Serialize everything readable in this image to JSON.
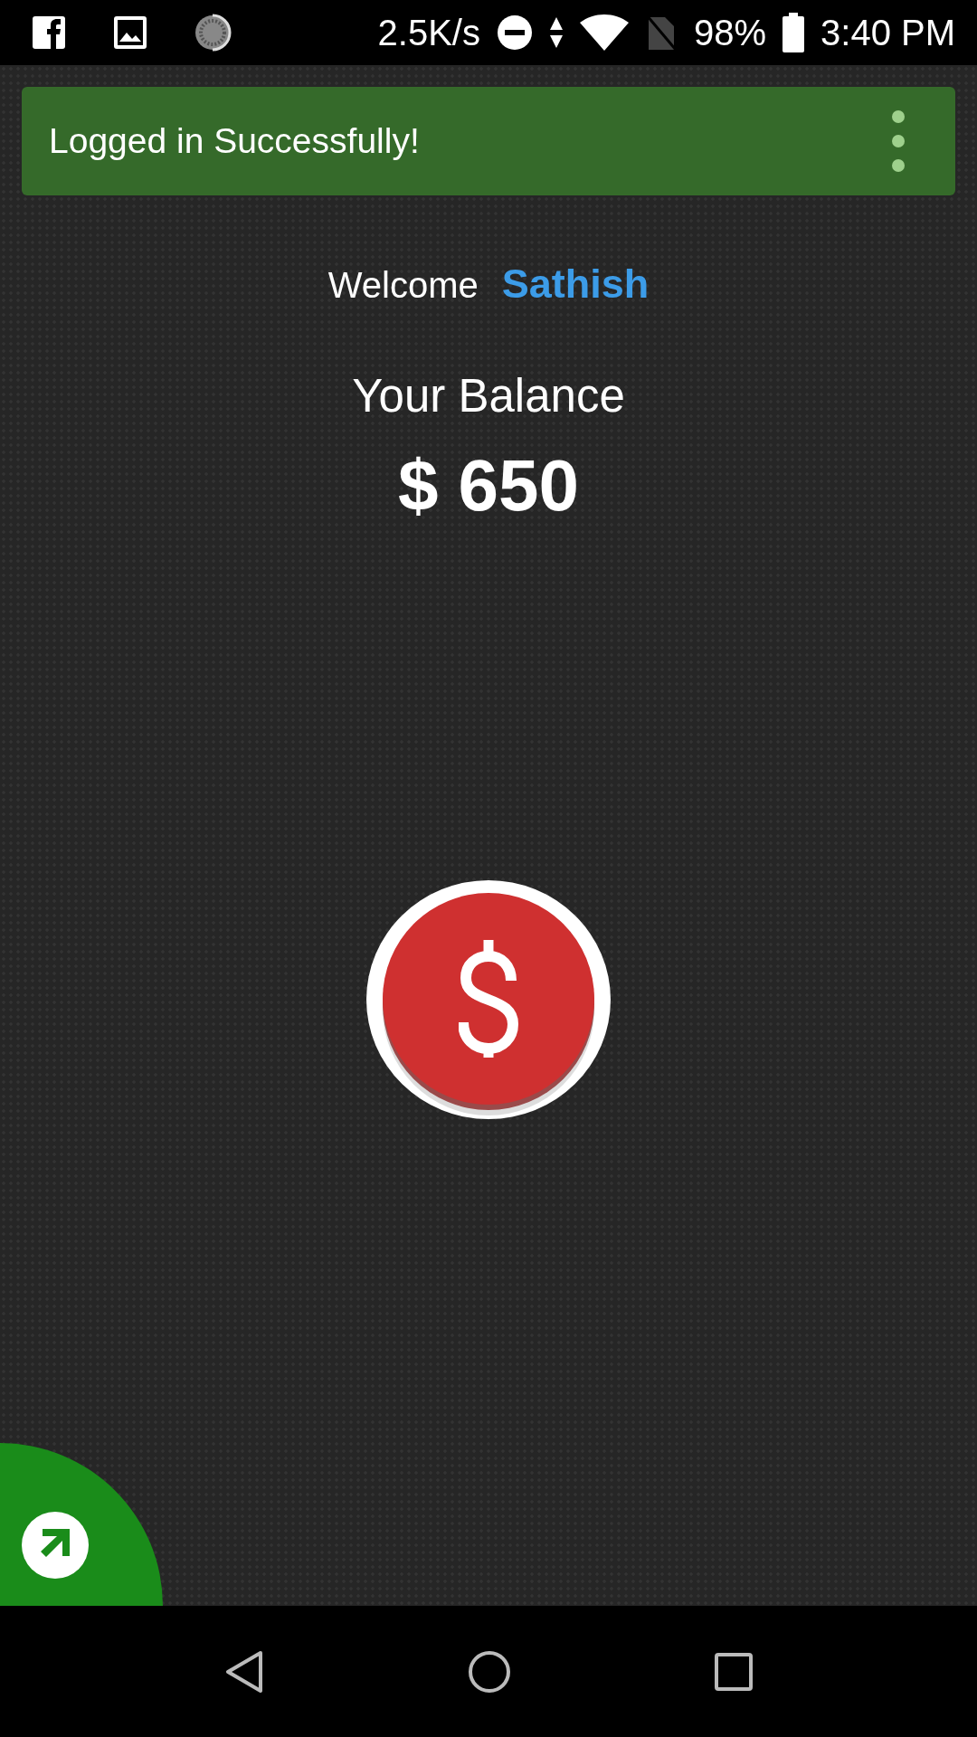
{
  "status_bar": {
    "net_speed": "2.5K/s",
    "battery": "98%",
    "time": "3:40 PM"
  },
  "snackbar": {
    "message": "Logged in Successfully!"
  },
  "welcome": {
    "greeting": "Welcome",
    "user": "Sathish"
  },
  "balance": {
    "label": "Your Balance",
    "amount": "$ 650"
  }
}
